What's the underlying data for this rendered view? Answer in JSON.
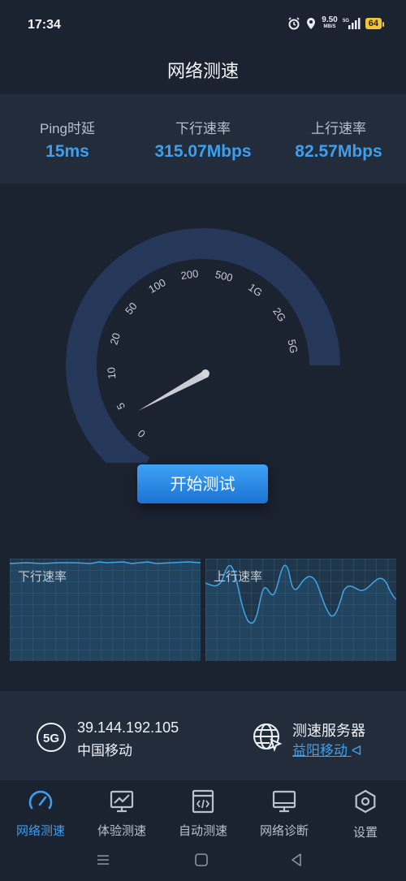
{
  "status_bar": {
    "time": "17:34",
    "net_speed_value": "9.50",
    "net_speed_unit": "MB/S",
    "network": "5G",
    "battery": "64"
  },
  "page_title": "网络测速",
  "stats": [
    {
      "label": "Ping时延",
      "value": "15ms"
    },
    {
      "label": "下行速率",
      "value": "315.07Mbps"
    },
    {
      "label": "上行速率",
      "value": "82.57Mbps"
    }
  ],
  "gauge": {
    "scale_labels": [
      "0",
      "5",
      "10",
      "20",
      "50",
      "100",
      "200",
      "500",
      "1G",
      "2G",
      "5G"
    ],
    "needle_value": "0"
  },
  "start_button": "开始测试",
  "graphs": {
    "download_label": "下行速率",
    "upload_label": "上行速率"
  },
  "connection": {
    "badge": "5G",
    "ip": "39.144.192.105",
    "carrier": "中国移动"
  },
  "server": {
    "label": "测速服务器",
    "name": "益阳移动"
  },
  "nav": [
    {
      "label": "网络测速",
      "icon": "speedometer-icon",
      "active": true
    },
    {
      "label": "体验测速",
      "icon": "monitor-chart-icon",
      "active": false
    },
    {
      "label": "自动测速",
      "icon": "code-window-icon",
      "active": false
    },
    {
      "label": "网络诊断",
      "icon": "desktop-icon",
      "active": false
    },
    {
      "label": "设置",
      "icon": "hexagon-gear-icon",
      "active": false
    }
  ],
  "colors": {
    "accent": "#3d9ff0",
    "background": "#1b2230",
    "panel": "#232c3b",
    "gauge_arc": "#26385a"
  }
}
